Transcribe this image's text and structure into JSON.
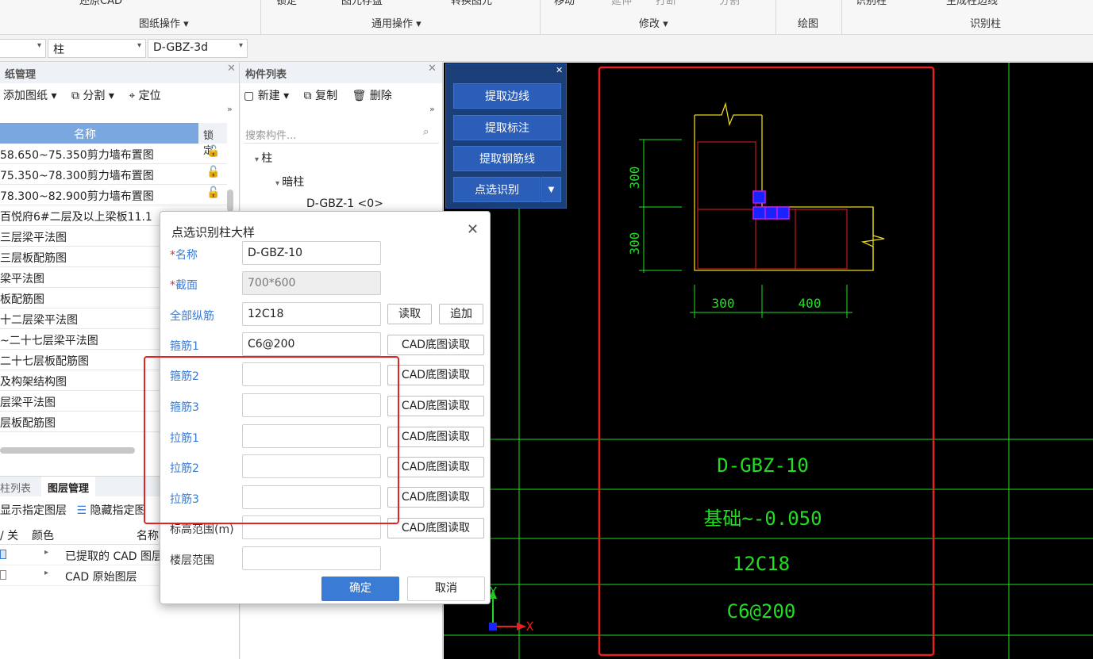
{
  "ribbon": {
    "top_items": [
      "还原CAD",
      "锁定",
      "图元存盘",
      "转换图元",
      "移动",
      "延伸",
      "打断",
      "分割",
      "识别柱",
      "生成柱边线"
    ],
    "groups": [
      "图纸操作 ▾",
      "通用操作 ▾",
      "修改 ▾",
      "绘图",
      "识别柱"
    ]
  },
  "selectors": {
    "first": "",
    "second": "柱",
    "third": "D-GBZ-3d"
  },
  "drawing_panel": {
    "title": "纸管理",
    "toolbar": [
      "添加图纸 ▾",
      "分割 ▾",
      "定位"
    ],
    "header_name": "名称",
    "header_lock": "锁定",
    "rows": [
      "58.650~75.350剪力墙布置图",
      "75.350~78.300剪力墙布置图",
      "78.300~82.900剪力墙布置图",
      "百悦府6#二层及以上梁板11.1",
      "三层梁平法图",
      "三层板配筋图",
      "梁平法图",
      "板配筋图",
      "十二层梁平法图",
      "~二十七层梁平法图",
      "二十七层板配筋图",
      "及构架结构图",
      "层梁平法图",
      "层板配筋图"
    ]
  },
  "layer_panel": {
    "tabs": [
      "柱列表",
      "图层管理"
    ],
    "toolbar": [
      "显示指定图层",
      "隐藏指定图"
    ],
    "headers": [
      "/ 关",
      "颜色",
      "名称"
    ],
    "rows": [
      "已提取的 CAD 图层",
      "CAD 原始图层"
    ]
  },
  "component_panel": {
    "title": "构件列表",
    "toolbar": [
      "新建 ▾",
      "复制",
      "删除"
    ],
    "search_placeholder": "搜索构件...",
    "tree": [
      "柱",
      "暗柱",
      "D-GBZ-1 <0>"
    ]
  },
  "float_tool": [
    "提取边线",
    "提取标注",
    "提取钢筋线",
    "点选识别"
  ],
  "dialog": {
    "title": "点选识别柱大样",
    "fields": {
      "name_label": "名称",
      "name_value": "D-GBZ-10",
      "section_label": "截面",
      "section_value": "700*600",
      "rebar_label": "全部纵筋",
      "rebar_value": "12C18",
      "read": "读取",
      "append": "追加",
      "stirrup1_label": "箍筋1",
      "stirrup1_value": "C6@200",
      "stirrup2_label": "箍筋2",
      "stirrup3_label": "箍筋3",
      "tie1_label": "拉筋1",
      "tie2_label": "拉筋2",
      "tie3_label": "拉筋3",
      "elev_label": "标高范围(m)",
      "floor_label": "楼层范围",
      "cad_read": "CAD底图读取"
    },
    "ok": "确定",
    "cancel": "取消"
  },
  "cad": {
    "dim_left_top": "300",
    "dim_left_bottom": "300",
    "dim_bottom_left": "300",
    "dim_bottom_right": "400",
    "table_name": "D-GBZ-10",
    "table_elev": "基础~-0.050",
    "table_rebar": "12C18",
    "table_stirrup": "C6@200",
    "axis_x": "X",
    "axis_y": "Y"
  },
  "colors": {
    "accent": "#3a7bd5",
    "highlight": "#e52121",
    "cad_green": "#22dd22",
    "cad_yellow": "#e8d81a"
  }
}
